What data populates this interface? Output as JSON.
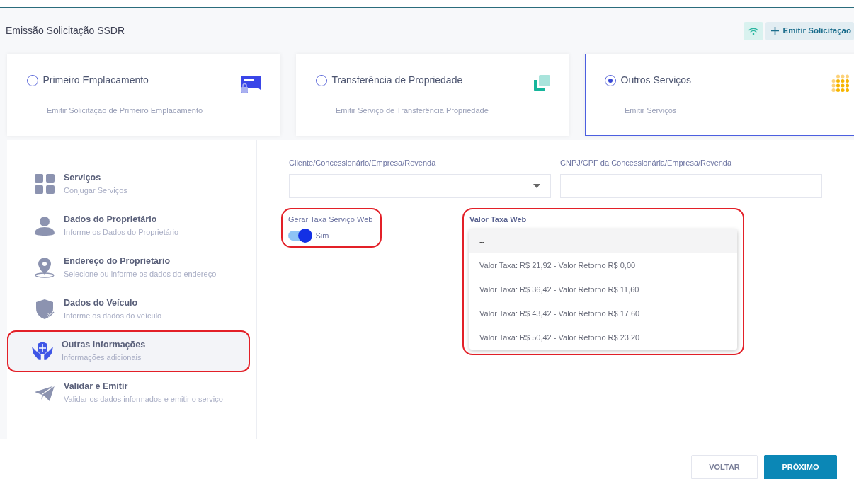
{
  "header": {
    "title": "Emissão Solicitação SSDR",
    "emit_button": "Emitir Solicitação"
  },
  "service_options": [
    {
      "title": "Primeiro Emplacamento",
      "subtitle": "Emitir Solicitação de Primeiro Emplacamento",
      "selected": false
    },
    {
      "title": "Transferência de Propriedade",
      "subtitle": "Emitir Serviço de Transferência Propriedade",
      "selected": false
    },
    {
      "title": "Outros Serviços",
      "subtitle": "Emitir Serviços",
      "selected": true
    }
  ],
  "steps": [
    {
      "title": "Serviços",
      "subtitle": "Conjugar Serviços",
      "selected": false,
      "highlighted": false
    },
    {
      "title": "Dados do Proprietário",
      "subtitle": "Informe os Dados do Proprietário",
      "selected": false,
      "highlighted": false
    },
    {
      "title": "Endereço do Proprietário",
      "subtitle": "Selecione ou informe os dados do endereço",
      "selected": false,
      "highlighted": false
    },
    {
      "title": "Dados do Veículo",
      "subtitle": "Informe os dados do veículo",
      "selected": false,
      "highlighted": false
    },
    {
      "title": "Outras Informações",
      "subtitle": "Informações adicionais",
      "selected": true,
      "highlighted": true
    },
    {
      "title": "Validar e Emitir",
      "subtitle": "Validar os dados informados e emitir o serviço",
      "selected": false,
      "highlighted": false
    }
  ],
  "form": {
    "client_label": "Cliente/Concessionário/Empresa/Revenda",
    "cnpj_label": "CNPJ/CPF da Concessionária/Empresa/Revenda",
    "toggle": {
      "label": "Gerar Taxa Serviço Web",
      "on": true,
      "value_text": "Sim",
      "highlighted": true
    },
    "dropdown": {
      "label": "Valor Taxa Web",
      "highlighted": true,
      "options": [
        {
          "text": "--",
          "selected": true
        },
        {
          "text": "Valor Taxa: R$ 21,92 - Valor Retorno R$ 0,00",
          "selected": false
        },
        {
          "text": "Valor Taxa: R$ 36,42 - Valor Retorno R$ 11,60",
          "selected": false
        },
        {
          "text": "Valor Taxa: R$ 43,42 - Valor Retorno R$ 17,60",
          "selected": false
        },
        {
          "text": "Valor Taxa: R$ 50,42 - Valor Retorno R$ 23,20",
          "selected": false
        }
      ]
    }
  },
  "footer": {
    "back_button": "VOLTAR",
    "next_button": "PRÓXIMO"
  }
}
